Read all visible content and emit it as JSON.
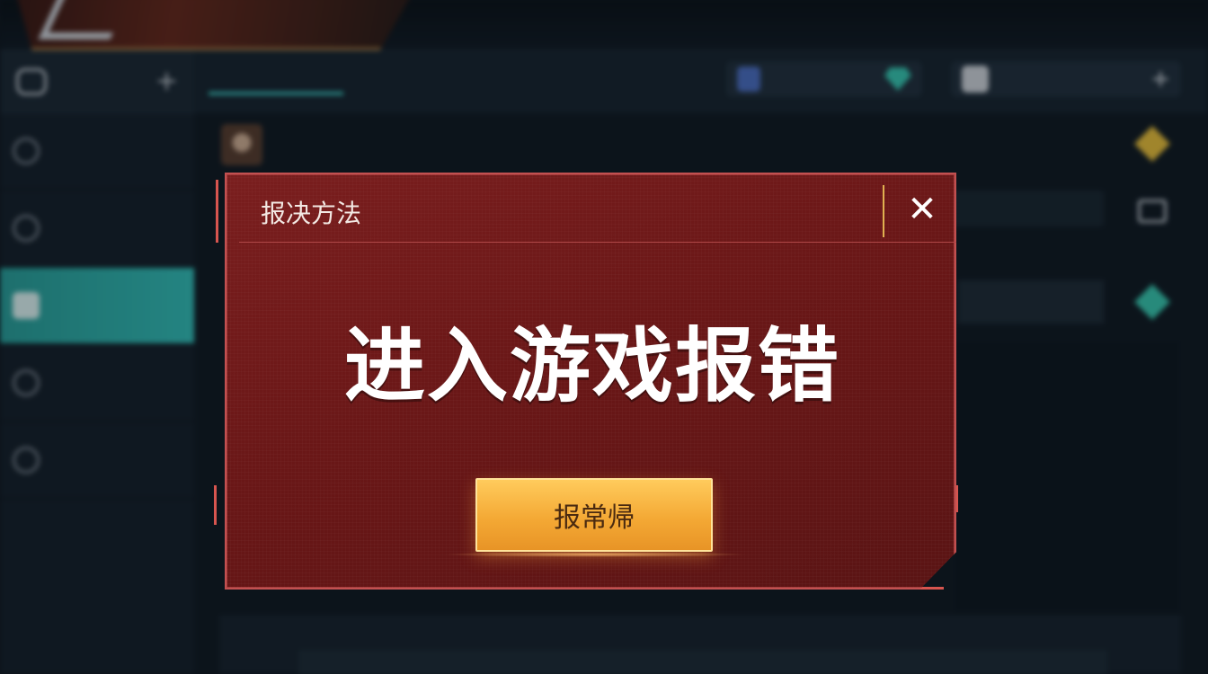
{
  "background": {
    "logo_subtitle": "",
    "sidebar": {
      "header_label": "",
      "items": [
        {
          "label": "",
          "active": false
        },
        {
          "label": "",
          "active": false
        },
        {
          "label": "",
          "active": true
        },
        {
          "label": "",
          "active": false
        },
        {
          "label": "",
          "active": false
        }
      ]
    },
    "main": {
      "tab_label": "",
      "pill_a_text": "",
      "pill_b_text": "",
      "user_name": "",
      "bottom_small_text": ""
    }
  },
  "dialog": {
    "title": "报决方法",
    "close_icon": "close-icon",
    "message": "进入游戏报错",
    "action_label": "报常帰"
  },
  "colors": {
    "dialog_bg": "#6a1717",
    "dialog_border": "#c25050",
    "button_gold": "#f4a935",
    "accent_teal": "#35c7c0",
    "separator_gold": "#e0b050"
  }
}
